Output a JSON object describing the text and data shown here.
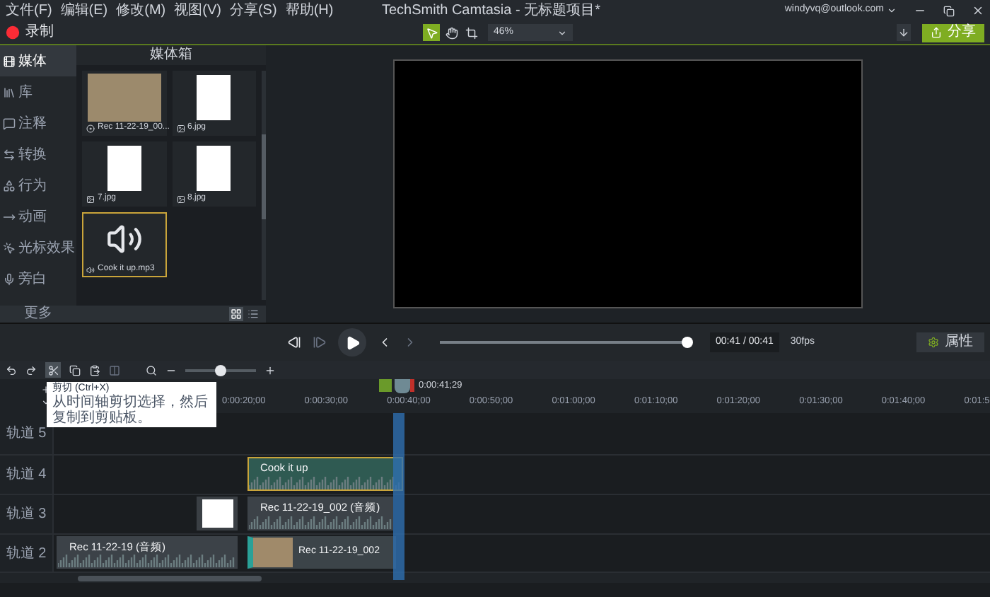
{
  "menu": [
    "文件(F)",
    "编辑(E)",
    "修改(M)",
    "视图(V)",
    "分享(S)",
    "帮助(H)"
  ],
  "window": {
    "title": "TechSmith Camtasia - 无标题项目*",
    "account": "windyvq@outlook.com"
  },
  "toolbar": {
    "record": "录制",
    "tools": [
      {
        "kind": "select",
        "selected": true
      },
      {
        "kind": "pan",
        "selected": false
      },
      {
        "kind": "crop",
        "selected": false
      }
    ],
    "zoom": "46%",
    "share": "分享"
  },
  "sidebar": {
    "items": [
      {
        "kind": "media",
        "label": "媒体",
        "selected": true
      },
      {
        "kind": "library",
        "label": "库",
        "selected": false
      },
      {
        "kind": "annotations",
        "label": "注释",
        "selected": false
      },
      {
        "kind": "transitions",
        "label": "转换",
        "selected": false
      },
      {
        "kind": "behaviors",
        "label": "行为",
        "selected": false
      },
      {
        "kind": "animations",
        "label": "动画",
        "selected": false
      },
      {
        "kind": "cursor",
        "label": "光标效果",
        "selected": false
      },
      {
        "kind": "voice",
        "label": "旁白",
        "selected": false
      }
    ],
    "more": "更多"
  },
  "media_bin": {
    "title": "媒体箱",
    "items": [
      {
        "kind": "video",
        "label": "Rec 11-22-19_00...",
        "selected": false
      },
      {
        "kind": "image",
        "label": "6.jpg",
        "selected": false
      },
      {
        "kind": "image",
        "label": "7.jpg",
        "selected": false
      },
      {
        "kind": "image",
        "label": "8.jpg",
        "selected": false
      },
      {
        "kind": "audio",
        "label": "Cook it up.mp3",
        "selected": true
      }
    ],
    "views": [
      {
        "kind": "grid",
        "selected": true
      },
      {
        "kind": "list",
        "selected": false
      }
    ]
  },
  "playback": {
    "level": 1,
    "time": "00:41 / 00:41",
    "fps": "30fps",
    "properties": "属性"
  },
  "timeline": {
    "zoom": {
      "level": 0.5
    },
    "tooltip": {
      "title": "剪切 (Ctrl+X)",
      "text": "从时间轴剪切选择，然后复制到剪贴板。"
    },
    "playhead_time": "0:00:41;29",
    "ruler": [
      "0:00:20;00",
      "0:00:30;00",
      "0:00:40;00",
      "0:00:50;00",
      "0:01:00;00",
      "0:01:10;00",
      "0:01:20;00",
      "0:01:30;00",
      "0:01:40;00",
      "0:01:5"
    ],
    "tracks": [
      {
        "name": "轨道 5"
      },
      {
        "name": "轨道 4",
        "clips": [
          {
            "kind": "audio",
            "label": "Cook it up",
            "selected": true
          }
        ]
      },
      {
        "name": "轨道 3",
        "clips": [
          {
            "kind": "image",
            "selected": false
          },
          {
            "kind": "audio",
            "label": "Rec 11-22-19_002 (音频)",
            "selected": false
          }
        ]
      },
      {
        "name": "轨道 2",
        "clips": [
          {
            "kind": "audio",
            "label": "Rec 11-22-19 (音频)",
            "selected": false
          },
          {
            "kind": "video",
            "label": "Rec 11-22-19_002",
            "selected": false
          }
        ]
      }
    ]
  }
}
